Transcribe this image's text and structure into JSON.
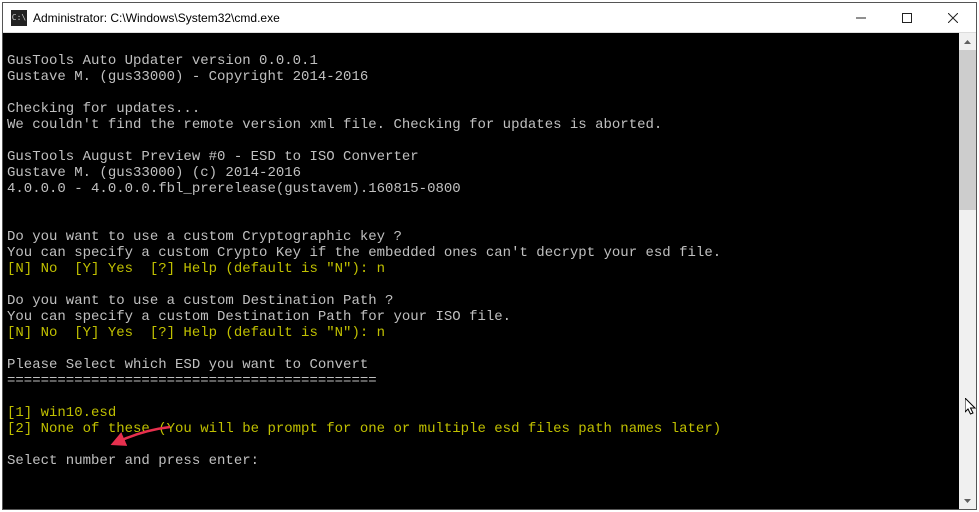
{
  "window": {
    "title": "Administrator: C:\\Windows\\System32\\cmd.exe",
    "icon_glyph": "C:\\"
  },
  "console": {
    "lines": [
      {
        "text": "",
        "cls": ""
      },
      {
        "text": "GusTools Auto Updater version 0.0.0.1",
        "cls": ""
      },
      {
        "text": "Gustave M. (gus33000) - Copyright 2014-2016",
        "cls": ""
      },
      {
        "text": "",
        "cls": ""
      },
      {
        "text": "Checking for updates...",
        "cls": ""
      },
      {
        "text": "We couldn't find the remote version xml file. Checking for updates is aborted.",
        "cls": ""
      },
      {
        "text": "",
        "cls": ""
      },
      {
        "text": "GusTools August Preview #0 - ESD to ISO Converter",
        "cls": ""
      },
      {
        "text": "Gustave M. (gus33000) (c) 2014-2016",
        "cls": ""
      },
      {
        "text": "4.0.0.0 - 4.0.0.0.fbl_prerelease(gustavem).160815-0800",
        "cls": ""
      },
      {
        "text": "",
        "cls": ""
      },
      {
        "text": "",
        "cls": ""
      },
      {
        "text": "Do you want to use a custom Cryptographic key ?",
        "cls": ""
      },
      {
        "text": "You can specify a custom Crypto Key if the embedded ones can't decrypt your esd file.",
        "cls": ""
      },
      {
        "text": "[N] No  [Y] Yes  [?] Help (default is \"N\"): n",
        "cls": "line-yellow"
      },
      {
        "text": "",
        "cls": ""
      },
      {
        "text": "Do you want to use a custom Destination Path ?",
        "cls": ""
      },
      {
        "text": "You can specify a custom Destination Path for your ISO file.",
        "cls": ""
      },
      {
        "text": "[N] No  [Y] Yes  [?] Help (default is \"N\"): n",
        "cls": "line-yellow"
      },
      {
        "text": "",
        "cls": ""
      },
      {
        "text": "Please Select which ESD you want to Convert",
        "cls": ""
      },
      {
        "text": "============================================",
        "cls": ""
      },
      {
        "text": "",
        "cls": ""
      },
      {
        "text": "[1] win10.esd",
        "cls": "line-yellow"
      },
      {
        "text": "[2] None of these (You will be prompt for one or multiple esd files path names later)",
        "cls": "line-yellow"
      },
      {
        "text": "",
        "cls": ""
      },
      {
        "text": "Select number and press enter:",
        "cls": ""
      }
    ]
  },
  "annotations": {
    "arrow_color": "#e7304e"
  }
}
